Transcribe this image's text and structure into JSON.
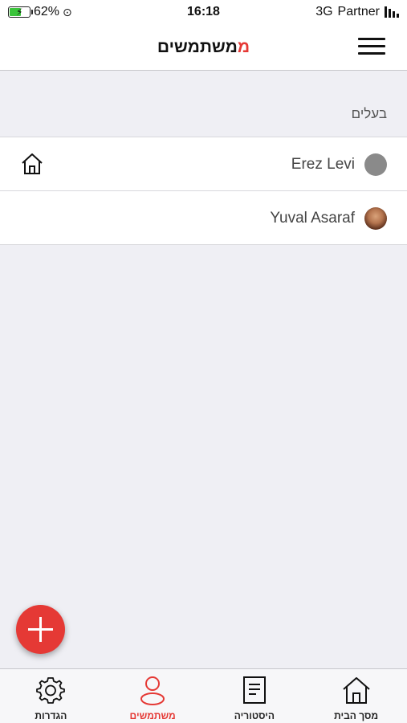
{
  "status_bar": {
    "battery_percent": "62%",
    "battery_level": 0.62,
    "time": "16:18",
    "network": "3G",
    "carrier": "Partner"
  },
  "header": {
    "title_accent": "מ",
    "title_rest": "משתמשים"
  },
  "section": {
    "label": "בעלים"
  },
  "users": [
    {
      "name": "Erez Levi",
      "avatar": "gray-circle",
      "badge_icon": "home-icon"
    },
    {
      "name": "Yuval Asaraf",
      "avatar": "photo"
    }
  ],
  "fab": {
    "icon": "plus-icon"
  },
  "tabs": [
    {
      "label": "הגדרות",
      "icon": "gear-icon"
    },
    {
      "label": "משתמשים",
      "icon": "user-icon",
      "active": true
    },
    {
      "label": "היסטוריה",
      "icon": "document-icon"
    },
    {
      "label": "מסך הבית",
      "icon": "home-icon"
    }
  ],
  "colors": {
    "accent": "#e53935",
    "background": "#efeff4",
    "battery": "#3ac43a"
  }
}
